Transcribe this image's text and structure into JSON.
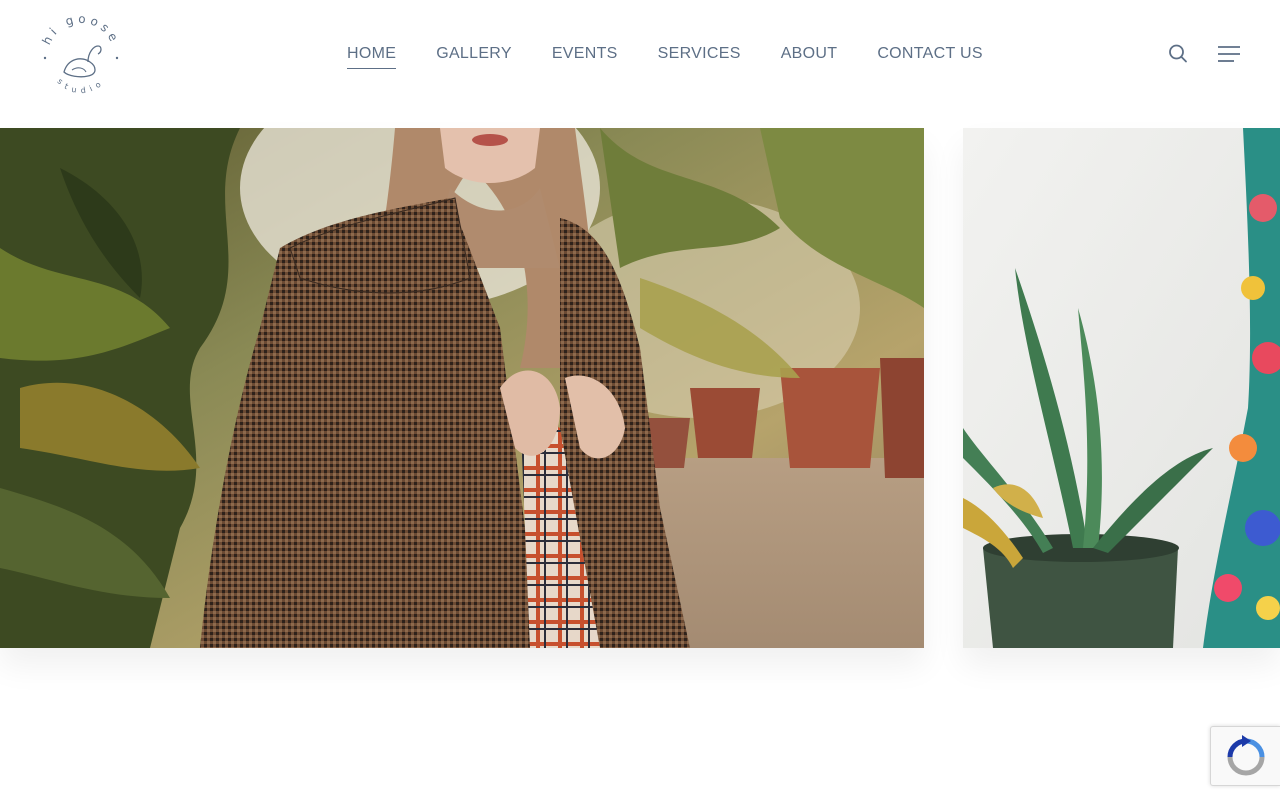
{
  "brand": {
    "logo_top_text": "hi goose",
    "logo_bottom_text": "studio"
  },
  "nav": {
    "items": [
      {
        "label": "HOME",
        "active": true
      },
      {
        "label": "GALLERY",
        "active": false
      },
      {
        "label": "EVENTS",
        "active": false
      },
      {
        "label": "SERVICES",
        "active": false
      },
      {
        "label": "ABOUT",
        "active": false
      },
      {
        "label": "CONTACT US",
        "active": false
      }
    ]
  },
  "icons": {
    "search": "search-icon",
    "menu": "hamburger-menu-icon",
    "recaptcha": "recaptcha-icon"
  },
  "slides": [
    {
      "subject": "woman in houndstooth coat among potted plants"
    },
    {
      "subject": "aloe plant in green pot beside floral dress"
    }
  ],
  "colors": {
    "nav_text": "#5d6f86",
    "background": "#ffffff"
  }
}
